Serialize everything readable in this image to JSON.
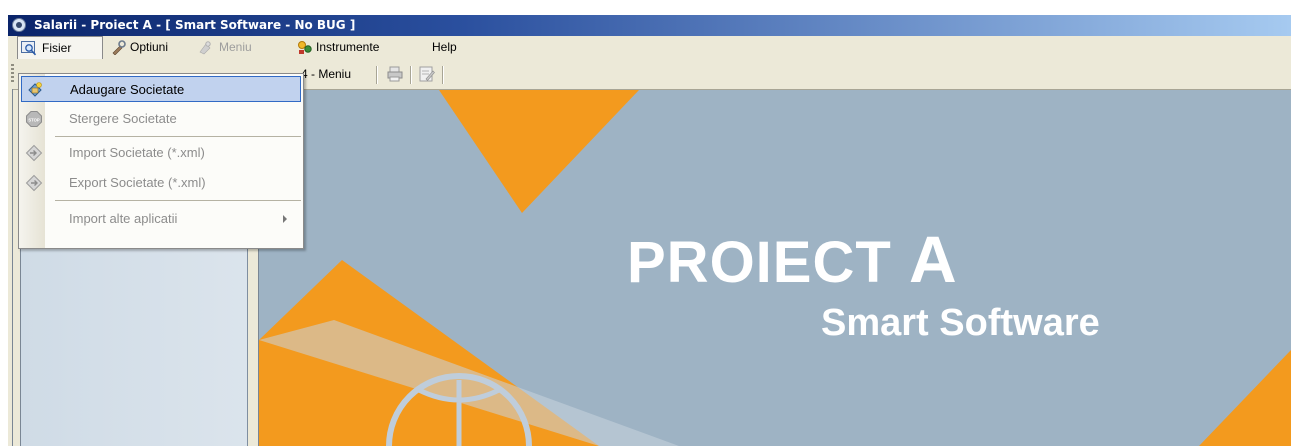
{
  "window": {
    "title": "Salarii - Proiect A  - [ Smart Software - No BUG ]"
  },
  "menubar": {
    "items": [
      {
        "label": "Fisier",
        "icon": "search-icon",
        "state": "open"
      },
      {
        "label": "Optiuni",
        "icon": "tools-icon"
      },
      {
        "label": "Meniu",
        "icon": "menu-icon",
        "state": "disabled"
      },
      {
        "label": "Instrumente",
        "icon": "instruments-icon"
      },
      {
        "label": "Help"
      }
    ]
  },
  "toolbar": {
    "label": "4 - Meniu"
  },
  "dropdown": {
    "items": [
      {
        "label": "Adaugare Societate",
        "icon": "add-company-icon",
        "state": "highlighted"
      },
      {
        "label": "Stergere Societate",
        "icon": "stop-icon",
        "state": "disabled"
      },
      {
        "label": "Import Societate (*.xml)",
        "icon": "import-icon",
        "state": "disabled"
      },
      {
        "label": "Export Societate (*.xml)",
        "icon": "export-icon",
        "state": "disabled"
      },
      {
        "label": "Import alte aplicatii",
        "has_submenu": true,
        "state": "disabled"
      }
    ]
  },
  "splash": {
    "title": "PROIECT",
    "title_letter": "A",
    "subtitle": "Smart Software"
  },
  "colors": {
    "accent_orange": "#f39a1e",
    "background_blue": "#9eb3c4",
    "titlebar_blue": "#0a246a"
  }
}
